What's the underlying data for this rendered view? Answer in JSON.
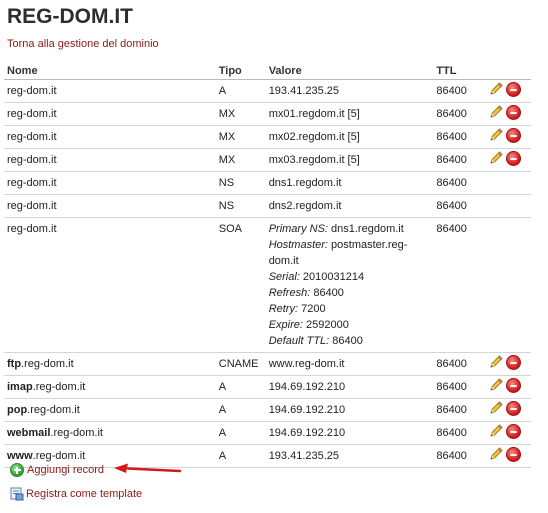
{
  "page": {
    "title": "REG-DOM.IT",
    "back_link": "Torna alla gestione del dominio"
  },
  "table": {
    "headers": {
      "nome": "Nome",
      "tipo": "Tipo",
      "valore": "Valore",
      "ttl": "TTL"
    },
    "rows": [
      {
        "nome_bold": "",
        "nome": "reg-dom.it",
        "tipo": "A",
        "valore": "193.41.235.25",
        "ttl": "86400",
        "actions": true
      },
      {
        "nome_bold": "",
        "nome": "reg-dom.it",
        "tipo": "MX",
        "valore": "mx01.regdom.it [5]",
        "ttl": "86400",
        "actions": true
      },
      {
        "nome_bold": "",
        "nome": "reg-dom.it",
        "tipo": "MX",
        "valore": "mx02.regdom.it [5]",
        "ttl": "86400",
        "actions": true
      },
      {
        "nome_bold": "",
        "nome": "reg-dom.it",
        "tipo": "MX",
        "valore": "mx03.regdom.it [5]",
        "ttl": "86400",
        "actions": true
      },
      {
        "nome_bold": "",
        "nome": "reg-dom.it",
        "tipo": "NS",
        "valore": "dns1.regdom.it",
        "ttl": "86400",
        "actions": false
      },
      {
        "nome_bold": "",
        "nome": "reg-dom.it",
        "tipo": "NS",
        "valore": "dns2.regdom.it",
        "ttl": "86400",
        "actions": false
      }
    ],
    "soa": {
      "nome": "reg-dom.it",
      "tipo": "SOA",
      "ttl": "86400",
      "lines": [
        {
          "k": "Primary NS:",
          "v": " dns1.regdom.it"
        },
        {
          "k": "Hostmaster:",
          "v": " postmaster.reg-"
        },
        {
          "k": "",
          "v": "dom.it"
        },
        {
          "k": "Serial:",
          "v": " 2010031214"
        },
        {
          "k": "Refresh:",
          "v": " 86400"
        },
        {
          "k": "Retry:",
          "v": " 7200"
        },
        {
          "k": "Expire:",
          "v": " 2592000"
        },
        {
          "k": "Default TTL:",
          "v": " 86400"
        }
      ]
    },
    "rows2": [
      {
        "nome_bold": "ftp",
        "nome": ".reg-dom.it",
        "tipo": "CNAME",
        "valore": "www.reg-dom.it",
        "ttl": "86400",
        "actions": true
      },
      {
        "nome_bold": "imap",
        "nome": ".reg-dom.it",
        "tipo": "A",
        "valore": "194.69.192.210",
        "ttl": "86400",
        "actions": true
      },
      {
        "nome_bold": "pop",
        "nome": ".reg-dom.it",
        "tipo": "A",
        "valore": "194.69.192.210",
        "ttl": "86400",
        "actions": true
      },
      {
        "nome_bold": "webmail",
        "nome": ".reg-dom.it",
        "tipo": "A",
        "valore": "194.69.192.210",
        "ttl": "86400",
        "actions": true
      },
      {
        "nome_bold": "www",
        "nome": ".reg-dom.it",
        "tipo": "A",
        "valore": "193.41.235.25",
        "ttl": "86400",
        "actions": true
      }
    ]
  },
  "footer": {
    "add_record": "Aggiungi record",
    "save_template": "Registra come template"
  },
  "icons": {
    "edit": "pencil-icon",
    "delete": "delete-icon",
    "add": "add-icon",
    "template": "template-icon",
    "arrow": "red-arrow-icon"
  },
  "colors": {
    "link": "#8b1a1a",
    "arrow": "#d11a1a",
    "delete": "#d8201f",
    "add": "#35a835"
  }
}
